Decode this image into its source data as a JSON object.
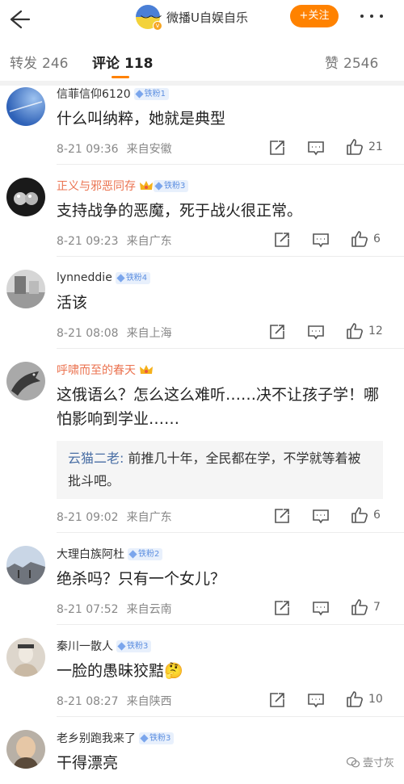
{
  "header": {
    "account_name": "微播U自娱自乐",
    "follow_label": "+关注"
  },
  "tabs": [
    {
      "label": "转发",
      "count": "246"
    },
    {
      "label": "评论",
      "count": "118"
    },
    {
      "label": "赞",
      "count": "2546"
    }
  ],
  "comments": [
    {
      "username": "信菲信仰6120",
      "name_color": "default",
      "crown": false,
      "badge": "铁粉1",
      "text": "什么叫纳粹，她就是典型",
      "time": "8-21 09:36",
      "location": "来自安徽",
      "likes": "21",
      "avatar_icon": "sky-avatar"
    },
    {
      "username": "正义与邪恶同存",
      "name_color": "orange",
      "crown": true,
      "badge": "铁粉3",
      "text": "支持战争的恶魔，死于战火很正常。",
      "time": "8-21 09:23",
      "location": "来自广东",
      "likes": "6",
      "avatar_icon": "spheres-avatar"
    },
    {
      "username": "lynneddie",
      "name_color": "default",
      "crown": false,
      "badge": "铁粉4",
      "text": "活该",
      "time": "8-21 08:08",
      "location": "来自上海",
      "likes": "12",
      "avatar_icon": "grey-photo-avatar"
    },
    {
      "username": "呼啸而至的春天",
      "name_color": "orange",
      "crown": true,
      "badge": "",
      "text": "这俄语么？怎么这么难听……决不让孩子学！哪怕影响到学业……",
      "reply_user": "云猫二老",
      "reply_text": "前推几十年，全民都在学，不学就等着被批斗吧。",
      "time": "8-21 09:02",
      "location": "来自广东",
      "likes": "6",
      "avatar_icon": "dragon-avatar"
    },
    {
      "username": "大理白族阿杜",
      "name_color": "default",
      "crown": false,
      "badge": "铁粉2",
      "text": "绝杀吗？只有一个女儿？",
      "time": "8-21 07:52",
      "location": "来自云南",
      "likes": "7",
      "avatar_icon": "landscape-avatar"
    },
    {
      "username": "秦川一散人",
      "name_color": "default",
      "crown": false,
      "badge": "铁粉3",
      "text": "一脸的愚昧狡黠🤔",
      "time": "8-21 08:27",
      "location": "来自陕西",
      "likes": "10",
      "avatar_icon": "statue-avatar"
    },
    {
      "username": "老乡别跑我来了",
      "name_color": "default",
      "crown": false,
      "badge": "铁粉3",
      "text": "干得漂亮",
      "time": "",
      "location": "",
      "likes": "",
      "avatar_icon": "monk-avatar"
    }
  ],
  "watermark": "壹寸灰",
  "colors": {
    "accent": "#ff8200",
    "orange_name": "#eb7350",
    "badge_bg": "#e8f0fc",
    "badge_text": "#5d8fe0"
  }
}
